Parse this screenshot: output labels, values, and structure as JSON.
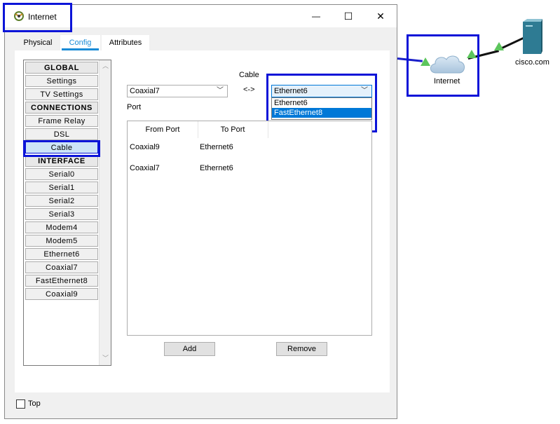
{
  "window": {
    "title": "Internet",
    "minimize_glyph": "—",
    "maximize_glyph": "☐",
    "close_glyph": "✕"
  },
  "tabs": [
    {
      "label": "Physical"
    },
    {
      "label": "Config",
      "active": true
    },
    {
      "label": "Attributes"
    }
  ],
  "sidebar": {
    "items": [
      {
        "label": "GLOBAL",
        "type": "header"
      },
      {
        "label": "Settings"
      },
      {
        "label": "TV Settings"
      },
      {
        "label": "CONNECTIONS",
        "type": "header"
      },
      {
        "label": "Frame Relay"
      },
      {
        "label": "DSL"
      },
      {
        "label": "Cable",
        "selected": true
      },
      {
        "label": "INTERFACE",
        "type": "header"
      },
      {
        "label": "Serial0"
      },
      {
        "label": "Serial1"
      },
      {
        "label": "Serial2"
      },
      {
        "label": "Serial3"
      },
      {
        "label": "Modem4"
      },
      {
        "label": "Modem5"
      },
      {
        "label": "Ethernet6"
      },
      {
        "label": "Coaxial7"
      },
      {
        "label": "FastEthernet8"
      },
      {
        "label": "Coaxial9"
      }
    ]
  },
  "cable_config": {
    "cable_label": "Cable",
    "arrow_label": "<->",
    "port_label": "Port",
    "left_select_value": "Coaxial7",
    "right_select_value": "Ethernet6",
    "right_options": [
      "Ethernet6",
      "FastEthernet8"
    ],
    "right_highlighted": "FastEthernet8",
    "table_headers": {
      "from": "From Port",
      "to": "To Port"
    },
    "rows": [
      {
        "from": "Coaxial9",
        "to": "Ethernet6"
      },
      {
        "from": "Coaxial7",
        "to": "Ethernet6"
      }
    ],
    "add_label": "Add",
    "remove_label": "Remove"
  },
  "footer": {
    "top_label": "Top",
    "top_checked": false
  },
  "topology": {
    "cloud_label": "Internet",
    "server_label": "cisco.com",
    "link_color": "#5cc55c"
  }
}
